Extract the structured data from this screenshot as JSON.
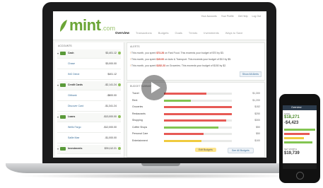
{
  "brand": {
    "logo_text": "mint",
    "logo_suffix": ".com",
    "green": "#6ba536"
  },
  "top_links": [
    "Your Accounts",
    "Your Profile",
    "Get Help",
    "Log Out"
  ],
  "nav": {
    "active": "Overview",
    "items": [
      "Overview",
      "Transactions",
      "Budgets",
      "Goals",
      "Trends",
      "Investments",
      "Ways to Save"
    ]
  },
  "sidebar": {
    "title": "ACCOUNTS",
    "rows": [
      {
        "kind": "group",
        "name": "Cash",
        "value": "$3,401.12"
      },
      {
        "kind": "item",
        "name": "Chase",
        "value": "$3,000.00"
      },
      {
        "kind": "item",
        "name": "ING Direct",
        "value": "$401.12"
      },
      {
        "kind": "group",
        "name": "Credit Cards",
        "value": "-$2,141.24"
      },
      {
        "kind": "item",
        "name": "Citibank",
        "value": "-$800.00"
      },
      {
        "kind": "item",
        "name": "Discover Card",
        "value": "-$1,341.24"
      },
      {
        "kind": "group",
        "name": "Loans",
        "value": "-$13,000.00"
      },
      {
        "kind": "item",
        "name": "Wells Fargo",
        "value": "-$12,000.00"
      },
      {
        "kind": "item",
        "name": "Sallie Mae",
        "value": "-$1,000.00"
      },
      {
        "kind": "group",
        "name": "Investments",
        "value": "$39,112.21"
      }
    ]
  },
  "alerts": {
    "title": "ALERTS",
    "items": [
      {
        "prefix": "This month, you spent ",
        "amount": "$73.28",
        "rest": " on Fast Food. This exceeds your budget of $70 by $3."
      },
      {
        "prefix": "This month, you spent ",
        "amount": "$15.00",
        "rest": " on Auto & Transport. This exceeds your budget of $10 by $5."
      },
      {
        "prefix": "This month, you spent ",
        "amount": "$152.23",
        "rest": " on Groceries. This exceeds your budget of $150 by $2."
      }
    ],
    "link": "Show All Alerts"
  },
  "budgets": {
    "title": "BUDGET SUMMARY",
    "rows": [
      {
        "label": "Travel",
        "fill": 0.62,
        "color": "#e75a55",
        "value": "$1,300"
      },
      {
        "label": "Rent",
        "fill": 0.4,
        "color": "#83c552",
        "value": "$1,200"
      },
      {
        "label": "Groceries",
        "fill": 1.0,
        "color": "#e75a55",
        "value": "$152"
      },
      {
        "label": "Restaurants",
        "fill": 1.0,
        "color": "#e75a55",
        "value": "$250"
      },
      {
        "label": "Shopping",
        "fill": 0.92,
        "color": "#e75a55",
        "value": "$300"
      },
      {
        "label": "Coffee Shops",
        "fill": 0.8,
        "color": "#83c552",
        "value": "$50"
      },
      {
        "label": "Personal Care",
        "fill": 0.58,
        "color": "#e75a55",
        "value": "$50"
      },
      {
        "label": "Entertainment",
        "fill": 0.55,
        "color": "#f0cb3f",
        "value": "$100"
      }
    ],
    "buttons": [
      "Edit Budgets",
      "See All Budgets"
    ]
  },
  "phone": {
    "title": "Overview",
    "cash_label": "CASH",
    "cash_value": "$18,271",
    "debt_value": "-$4,423",
    "net_label": "NET WORTH",
    "net_value": "$19,739"
  }
}
